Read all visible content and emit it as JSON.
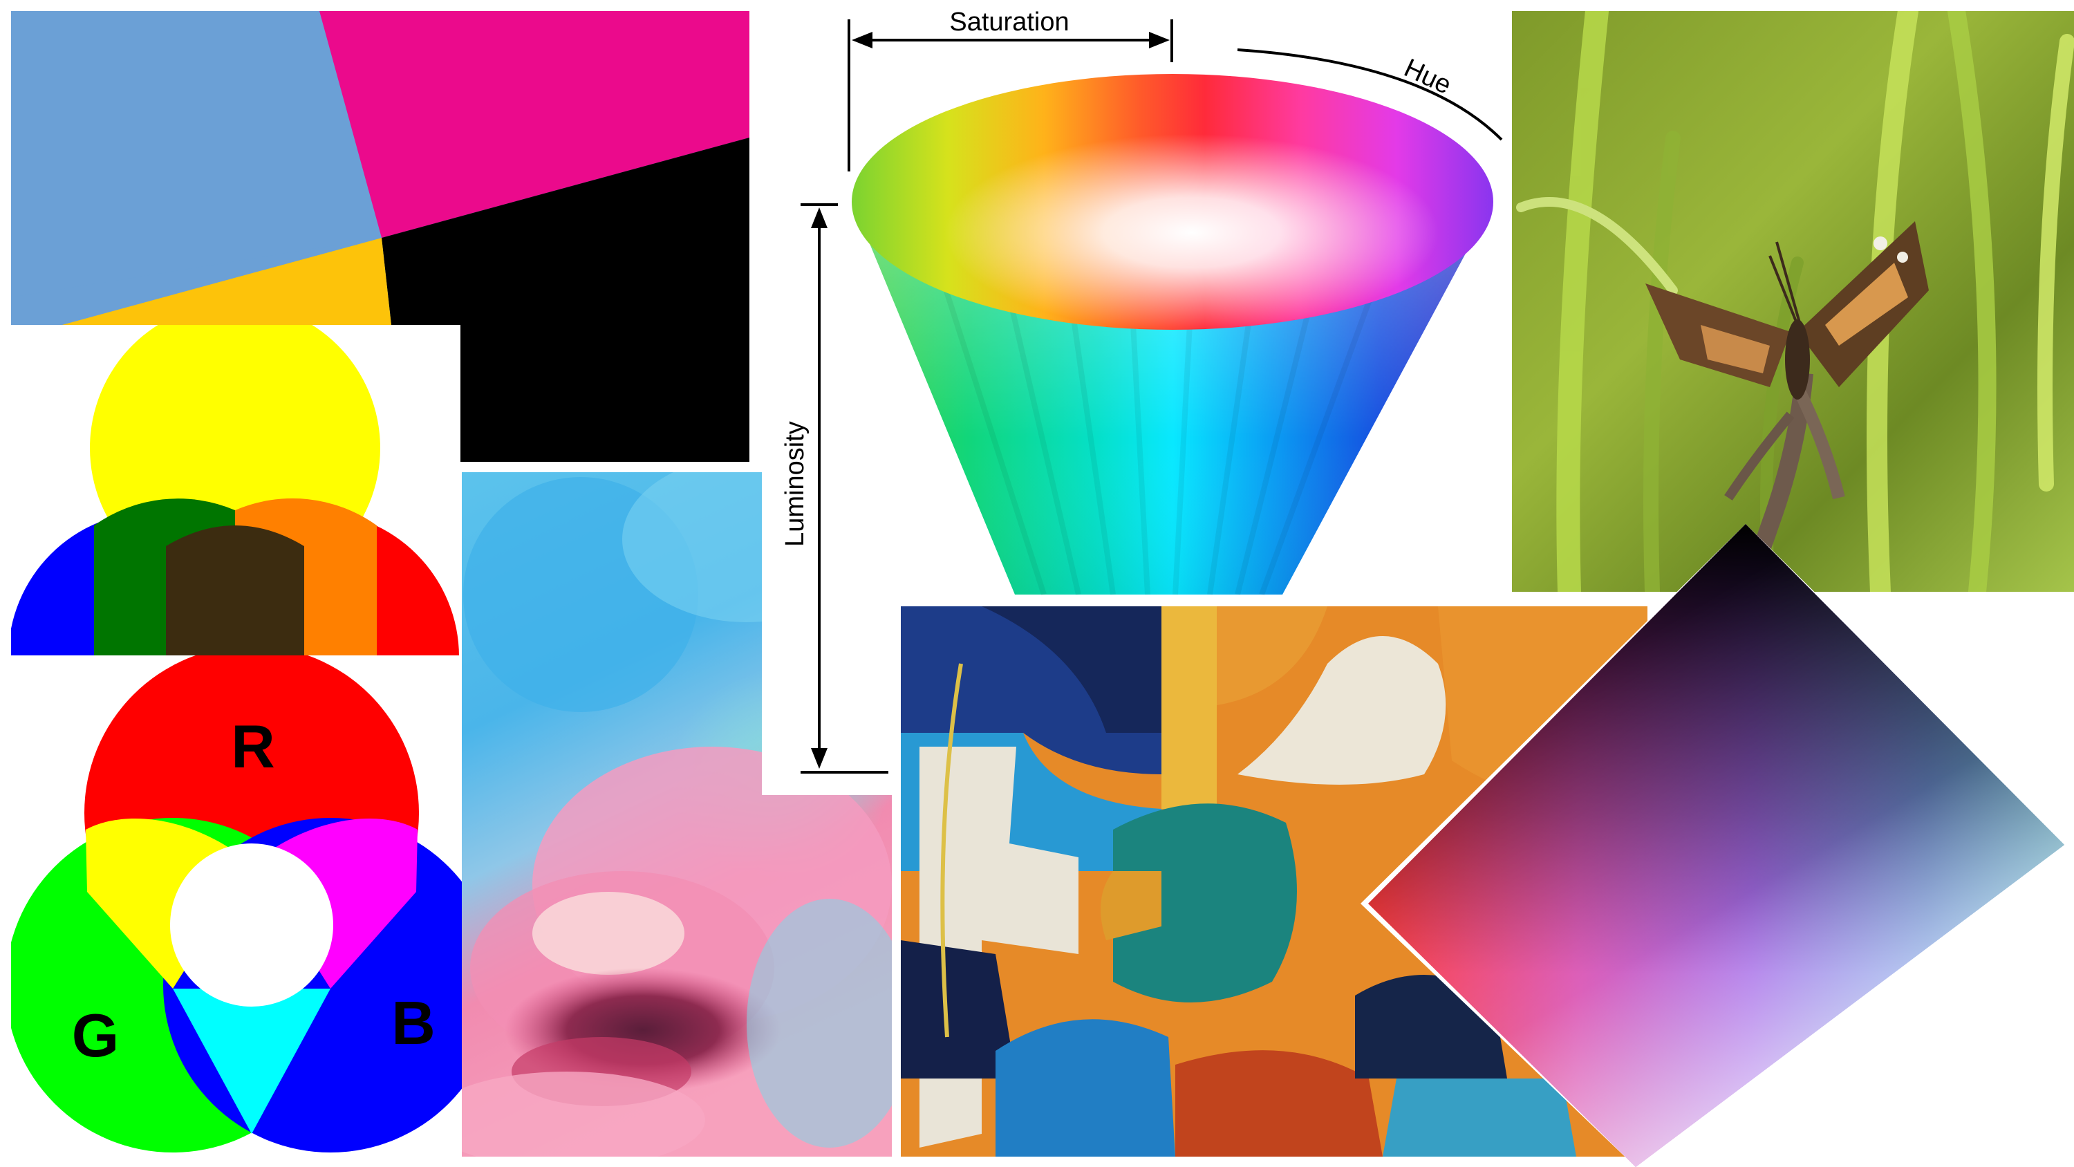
{
  "collage": {
    "hsl_cone": {
      "saturation_label": "Saturation",
      "hue_label": "Hue",
      "luminosity_label": "Luminosity"
    },
    "rgb_venn": {
      "red_label": "R",
      "green_label": "G",
      "blue_label": "B"
    },
    "colors": {
      "cmyk_blue": "#6ba0d6",
      "cmyk_magenta": "#eb0a8c",
      "cmyk_yellow": "#fdc30a",
      "cmyk_black": "#000000",
      "subtractive_yellow": "#ffff00",
      "subtractive_red": "#ff0000",
      "subtractive_blue": "#0000ff",
      "subtractive_green_overlap": "#007500",
      "subtractive_orange_overlap": "#ff8000",
      "subtractive_center": "#3c2c10",
      "rgb_red": "#ff0000",
      "rgb_green": "#00ff00",
      "rgb_blue": "#0000ff",
      "rgb_yellow": "#ffff00",
      "rgb_magenta": "#ff00ff",
      "rgb_cyan": "#00ffff",
      "rgb_white": "#ffffff"
    }
  }
}
